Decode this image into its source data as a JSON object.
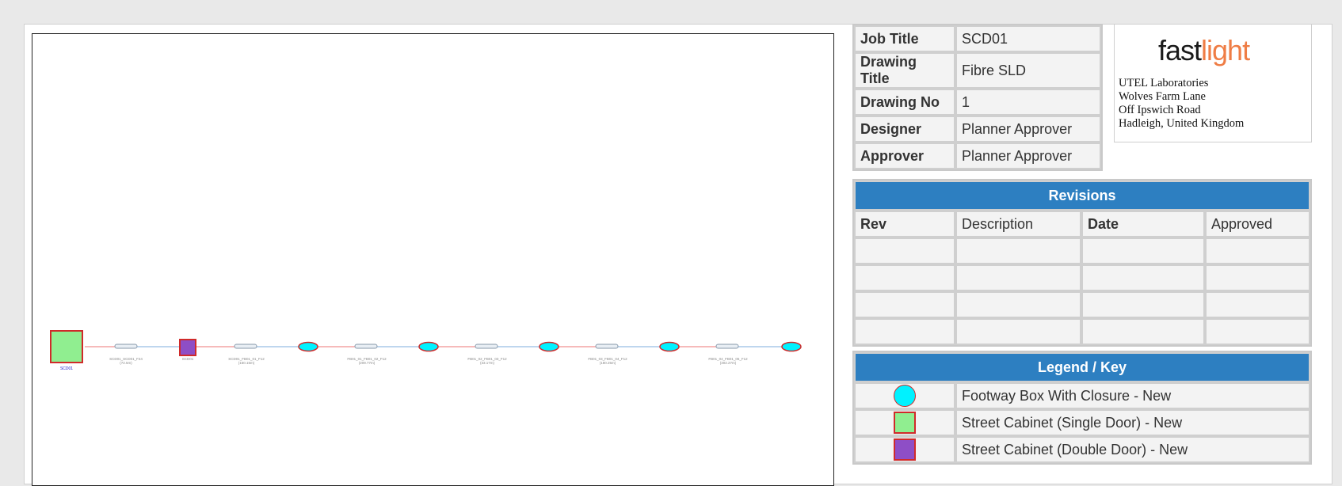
{
  "info": {
    "rows": [
      {
        "label": "Job Title",
        "value": "SCD01"
      },
      {
        "label": "Drawing Title",
        "value": "Fibre SLD"
      },
      {
        "label": "Drawing No",
        "value": "1"
      },
      {
        "label": "Designer",
        "value": "Planner Approver"
      },
      {
        "label": "Approver",
        "value": "Planner Approver"
      }
    ]
  },
  "logo": {
    "part1": "fast",
    "part2": "light",
    "address": [
      "UTEL Laboratories",
      "Wolves Farm Lane",
      "Off Ipswich Road",
      "Hadleigh, United Kingdom"
    ]
  },
  "revisions": {
    "title": "Revisions",
    "headers": [
      "Rev",
      "Description",
      "Date",
      "Approved"
    ],
    "rows": [
      [
        "",
        "",
        "",
        ""
      ],
      [
        "",
        "",
        "",
        ""
      ],
      [
        "",
        "",
        "",
        ""
      ],
      [
        "",
        "",
        "",
        ""
      ]
    ]
  },
  "legend": {
    "title": "Legend / Key",
    "items": [
      {
        "label": "Footway Box With Closure - New",
        "symbol": "footway-box",
        "fill": "#00f2ff",
        "stroke": "#d02a2a"
      },
      {
        "label": "Street Cabinet (Single Door) - New",
        "symbol": "street-cabinet-single",
        "fill": "#90ee90",
        "stroke": "#d02a2a"
      },
      {
        "label": "Street Cabinet (Double Door) - New",
        "symbol": "street-cabinet-double",
        "fill": "#8e4ec6",
        "stroke": "#d02a2a"
      }
    ]
  },
  "sld": {
    "start_label": "SCD01",
    "cable_labels": [
      "SCD01_SCD01_F24",
      "SCD01",
      "SCD01_FB01_01_F12",
      "FB01_01_FB01_02_F12",
      "FB01_02_FB01_03_F12",
      "FB01_03_FB01_04_F12",
      "FB01_04_FB01_05_F12"
    ],
    "cable_sublabels": [
      "(72.5m)",
      "",
      "(150.15m)",
      "(209.77m)",
      "(33.17m)",
      "(180.25m)",
      "(302.27m)"
    ],
    "colors": {
      "line_red": "#f4a4a4",
      "line_blue": "#a8c8e8",
      "label": "#888888",
      "start_label": "#2222cc"
    }
  }
}
